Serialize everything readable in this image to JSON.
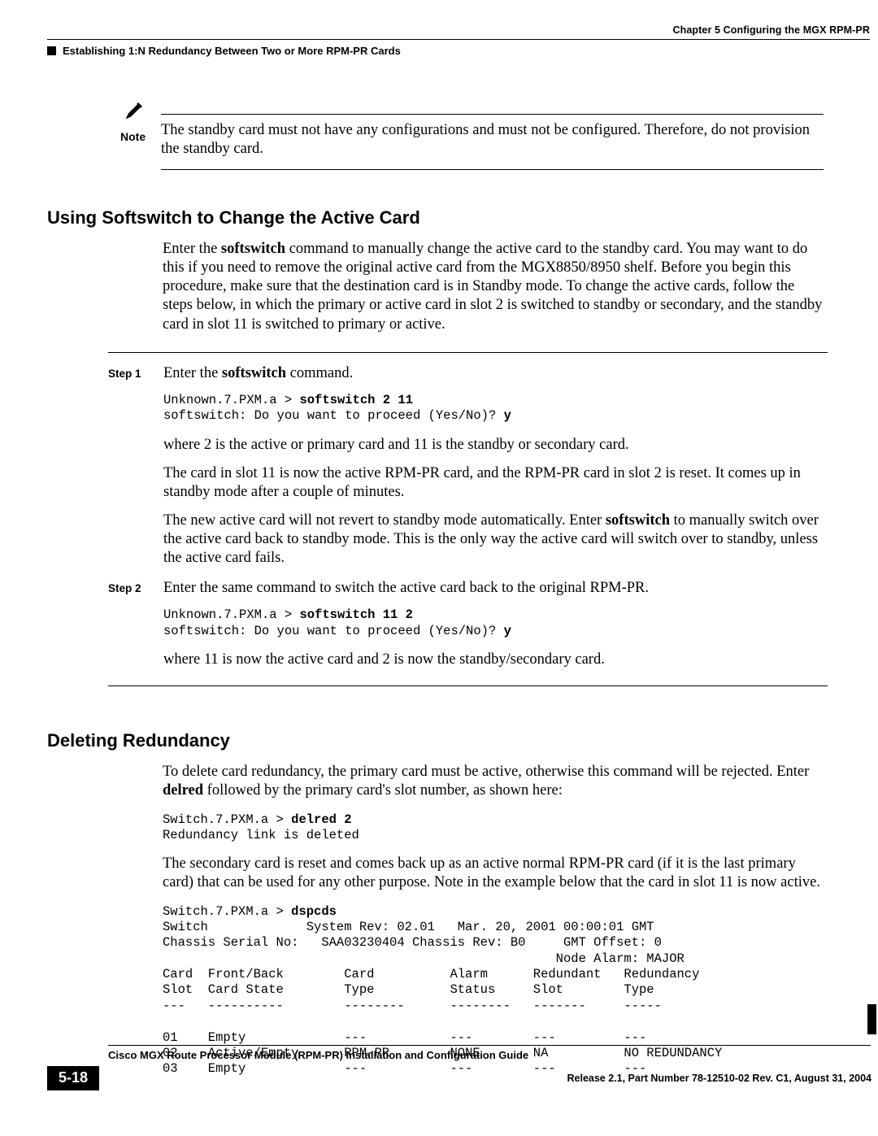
{
  "header": {
    "chapter": "Chapter 5    Configuring the MGX RPM-PR",
    "breadcrumb": "Establishing 1:N Redundancy Between Two or More RPM-PR Cards"
  },
  "note": {
    "label": "Note",
    "text": "The standby card must not have any configurations and must not be configured. Therefore, do not provision the standby card."
  },
  "section_softswitch": {
    "heading": "Using Softswitch to Change the Active Card",
    "intro_pre": "Enter the ",
    "intro_cmd": "softswitch",
    "intro_post": " command to manually change the active card to the standby card. You may want to do this if you need to remove the original active card from the MGX8850/8950 shelf. Before you begin this procedure, make sure that the destination card is in Standby mode. To change the active cards, follow the steps below, in which the primary or active card in slot 2 is switched to standby or secondary, and the standby card in slot 11 is switched to primary or active.",
    "step1_label": "Step 1",
    "step1_l1_pre": "Enter the ",
    "step1_l1_cmd": "softswitch",
    "step1_l1_post": " command.",
    "step1_code_p1": "Unknown.7.PXM.a > ",
    "step1_code_b1": "softswitch 2 11",
    "step1_code_p2": "\nsoftswitch: Do you want to proceed (Yes/No)? ",
    "step1_code_b2": "y",
    "step1_p2": "where 2 is the active or primary card and 11 is the standby or secondary card.",
    "step1_p3": "The card in slot 11 is now the active RPM-PR card, and the RPM-PR card in slot 2 is reset. It comes up in standby mode after a couple of minutes.",
    "step1_p4_pre": "The new active card will not revert to standby mode automatically. Enter ",
    "step1_p4_cmd": "softswitch",
    "step1_p4_post": " to manually switch over the active card back to standby mode. This is the only way the active card will switch over to standby, unless the active card fails.",
    "step2_label": "Step 2",
    "step2_l1": "Enter the same command to switch the active card back to the original RPM-PR.",
    "step2_code_p1": "Unknown.7.PXM.a > ",
    "step2_code_b1": "softswitch 11 2",
    "step2_code_p2": "\nsoftswitch: Do you want to proceed (Yes/No)? ",
    "step2_code_b2": "y",
    "step2_p2": "where 11 is now the active card and 2 is now the standby/secondary card."
  },
  "section_deleting": {
    "heading": "Deleting Redundancy",
    "p1_pre": "To delete card redundancy, the primary card must be active, otherwise this command will be rejected. Enter ",
    "p1_cmd": "delred",
    "p1_post": " followed by the primary card's slot number, as shown here:",
    "code1_p1": "Switch.7.PXM.a > ",
    "code1_b1": "delred 2",
    "code1_p2": "\nRedundancy link is deleted",
    "p2": "The secondary card is reset and comes back up as an active normal RPM-PR card (if it is the last primary card) that can be used for any other purpose. Note in the example below that the card in slot 11 is now active.",
    "code2_p1": "Switch.7.PXM.a > ",
    "code2_b1": "dspcds",
    "code2_rest": "\nSwitch             System Rev: 02.01   Mar. 20, 2001 00:00:01 GMT\nChassis Serial No:   SAA03230404 Chassis Rev: B0     GMT Offset: 0\n                                                    Node Alarm: MAJOR\nCard  Front/Back        Card          Alarm      Redundant   Redundancy\nSlot  Card State        Type          Status     Slot        Type\n---   ----------        --------      --------   -------     -----\n\n01    Empty             ---           ---        ---         ---\n02    Active/Empty      RPM-PR        NONE       NA          NO REDUNDANCY\n03    Empty             ---           ---        ---         ---"
  },
  "footer": {
    "guide": "Cisco MGX Route Processor Module (RPM-PR) Installation and Configuration Guide",
    "page": "5-18",
    "release": "Release 2.1, Part Number 78-12510-02 Rev. C1, August 31, 2004"
  }
}
